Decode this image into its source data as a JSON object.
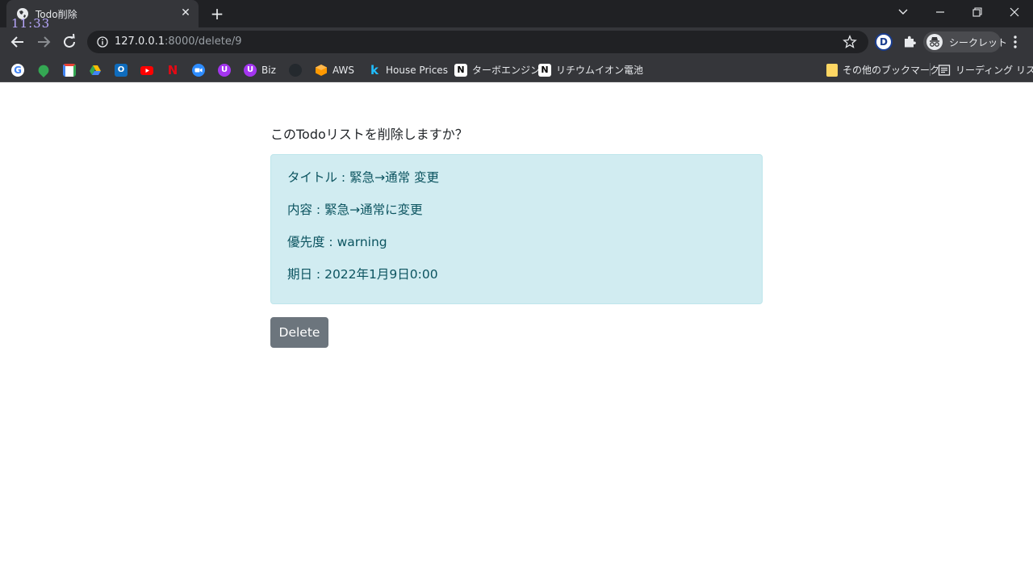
{
  "browser": {
    "tab_title": "Todo削除",
    "clock": "11:33",
    "url_host": "127.0.0.1",
    "url_path": ":8000/delete/9",
    "extension_letter": "D",
    "incognito_label": "シークレット"
  },
  "bookmarks": {
    "items": [
      {
        "label": "",
        "icon": "google-icon",
        "color": "#4285f4"
      },
      {
        "label": "",
        "icon": "maps-icon",
        "color": "#34a853"
      },
      {
        "label": "",
        "icon": "gmail-icon",
        "color": "#ea4335"
      },
      {
        "label": "",
        "icon": "drive-icon",
        "color": "#fbbc04"
      },
      {
        "label": "",
        "icon": "outlook-icon",
        "color": "#0f6cbd"
      },
      {
        "label": "",
        "icon": "youtube-icon",
        "color": "#ff0000"
      },
      {
        "label": "",
        "icon": "netflix-icon",
        "color": "#e50914"
      },
      {
        "label": "",
        "icon": "zoom-icon",
        "color": "#2d8cff"
      },
      {
        "label": "",
        "icon": "udemy-icon",
        "color": "#a435f0"
      },
      {
        "label": "Biz",
        "icon": "udemy-business-icon",
        "color": "#a435f0"
      },
      {
        "label": "",
        "icon": "github-icon",
        "color": "#24292e"
      },
      {
        "label": "AWS",
        "icon": "aws-icon",
        "color": "#ff9900"
      },
      {
        "label": "House Prices",
        "icon": "kaggle-icon",
        "color": "#20beff"
      },
      {
        "label": "ターボエンジン",
        "icon": "notion-icon",
        "color": "#ffffff"
      },
      {
        "label": "リチウムイオン電池",
        "icon": "notion-icon",
        "color": "#ffffff"
      }
    ],
    "other_bookmarks": "その他のブックマーク",
    "reading_list": "リーディング リスト"
  },
  "page": {
    "question": "このTodoリストを削除しますか？",
    "title_line": "タイトル : 緊急→通常 変更",
    "content_line": "内容 : 緊急→通常に変更",
    "priority_line": "優先度 : warning",
    "due_line": "期日 : 2022年1月9日0:00",
    "delete_label": "Delete"
  },
  "colors": {
    "card_bg": "#d1ecf1",
    "card_text": "#0c5460",
    "button_bg": "#6c757d"
  }
}
